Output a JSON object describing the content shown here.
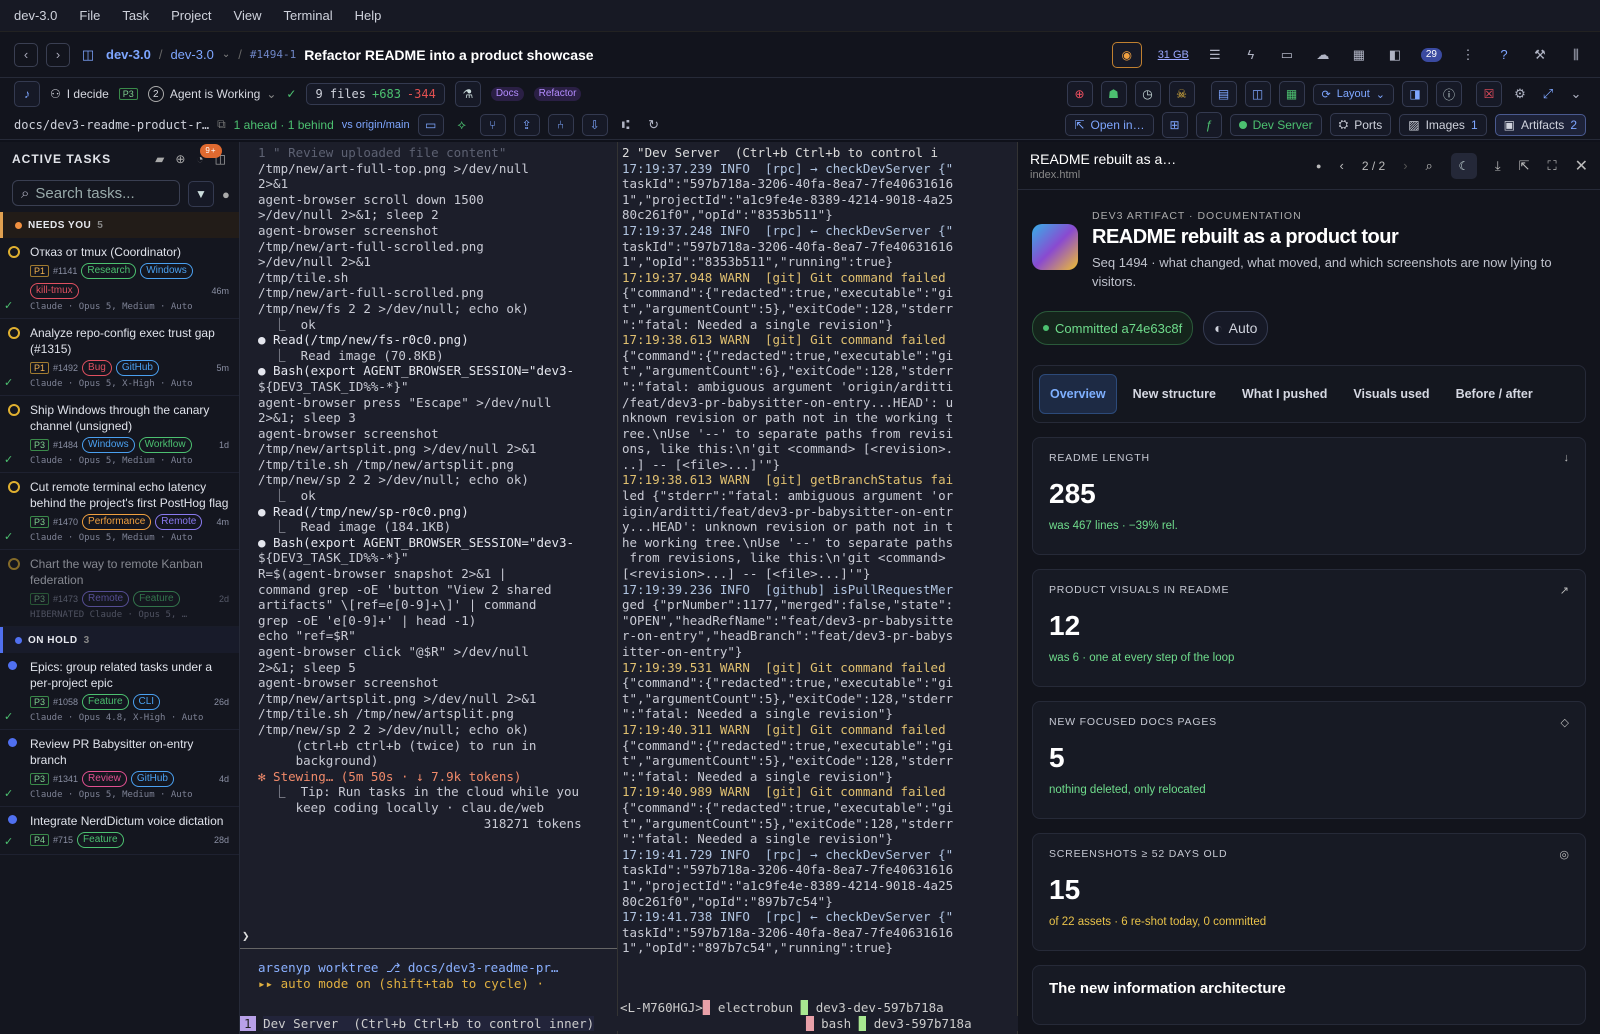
{
  "menu": [
    "dev-3.0",
    "File",
    "Task",
    "Project",
    "View",
    "Terminal",
    "Help"
  ],
  "titlebar": {
    "crumb1": "dev-3.0",
    "crumb2": "dev-3.0",
    "task_id": "#1494-1",
    "task_title": "Refactor README into a product showcase",
    "mem": "31 GB",
    "badge": "29"
  },
  "toolbar": {
    "decide": "I decide",
    "priority": "P3",
    "agent_num": "2",
    "agent_status": "Agent is Working",
    "files": "9 files",
    "added": "+683",
    "removed": "-344",
    "tag1": "Docs",
    "tag2": "Refactor",
    "layout": "Layout"
  },
  "toolbar2": {
    "branch": "docs/dev3-readme-product-r…",
    "ahead": "1 ahead · 1 behind",
    "origin": "vs origin/main",
    "open_in": "Open in…",
    "dev_server": "Dev Server",
    "ports": "Ports",
    "images": "Images",
    "images_n": "1",
    "artifacts": "Artifacts",
    "artifacts_n": "2"
  },
  "sidebar": {
    "title": "ACTIVE TASKS",
    "notif": "9+",
    "search_placeholder": "Search tasks...",
    "needs_label": "NEEDS YOU",
    "needs_count": "5",
    "hold_label": "ON HOLD",
    "hold_count": "3",
    "needs": [
      {
        "title": "Отказ от tmux (Coordinator)",
        "pri": "P1",
        "id": "#1141",
        "tags": [
          "Research",
          "Windows",
          "kill-tmux"
        ],
        "age": "46m",
        "foot": "Claude · Opus 5, Medium · Auto"
      },
      {
        "title": "Analyze repo-config exec trust gap (#1315)",
        "pri": "P1",
        "id": "#1492",
        "tags": [
          "Bug",
          "GitHub"
        ],
        "age": "5m",
        "foot": "Claude · Opus 5, X-High · Auto"
      },
      {
        "title": "Ship Windows through the canary channel (unsigned)",
        "pri": "P3",
        "id": "#1484",
        "tags": [
          "Windows",
          "Workflow"
        ],
        "age": "1d",
        "foot": "Claude · Opus 5, Medium · Auto"
      },
      {
        "title": "Cut remote terminal echo latency behind the project's first PostHog flag",
        "pri": "P3",
        "id": "#1470",
        "tags": [
          "Performance",
          "Remote"
        ],
        "age": "4m",
        "foot": "Claude · Opus 5, Medium · Auto"
      },
      {
        "title": "Chart the way to remote Kanban federation",
        "pri": "P3",
        "id": "#1473",
        "tags": [
          "Remote",
          "Feature"
        ],
        "age": "2d",
        "foot": "HIBERNATED  Claude · Opus 5, …"
      }
    ],
    "hold": [
      {
        "title": "Epics: group related tasks under a per-project epic",
        "pri": "P3",
        "id": "#1058",
        "tags": [
          "Feature",
          "CLI"
        ],
        "age": "26d",
        "foot": "Claude · Opus 4.8, X-High · Auto"
      },
      {
        "title": "Review PR Babysitter on-entry branch",
        "pri": "P3",
        "id": "#1341",
        "tags": [
          "Review",
          "GitHub"
        ],
        "age": "4d",
        "foot": "Claude · Opus 5, Medium · Auto"
      },
      {
        "title": "Integrate NerdDictum voice dictation",
        "pri": "P4",
        "id": "#715",
        "tags": [
          "Feature"
        ],
        "age": "28d",
        "foot": ""
      }
    ]
  },
  "term1": [
    "1 \" Review uploaded file content\"",
    "/tmp/new/art-full-top.png >/dev/null",
    "2>&1",
    "agent-browser scroll down 1500",
    ">/dev/null 2>&1; sleep 2",
    "agent-browser screenshot",
    "/tmp/new/art-full-scrolled.png",
    ">/dev/null 2>&1",
    "/tmp/tile.sh",
    "/tmp/new/art-full-scrolled.png",
    "/tmp/new/fs 2 2 >/dev/null; echo ok)",
    "  ⎿  ok",
    "",
    "● Read(/tmp/new/fs-r0c0.png)",
    "  ⎿  Read image (70.8KB)",
    "",
    "● Bash(export AGENT_BROWSER_SESSION=\"dev3-",
    "${DEV3_TASK_ID%%-*}\"",
    "agent-browser press \"Escape\" >/dev/null",
    "2>&1; sleep 3",
    "agent-browser screenshot",
    "/tmp/new/artsplit.png >/dev/null 2>&1",
    "/tmp/tile.sh /tmp/new/artsplit.png",
    "/tmp/new/sp 2 2 >/dev/null; echo ok)",
    "  ⎿  ok",
    "",
    "● Read(/tmp/new/sp-r0c0.png)",
    "  ⎿  Read image (184.1KB)",
    "",
    "● Bash(export AGENT_BROWSER_SESSION=\"dev3-",
    "${DEV3_TASK_ID%%-*}\"",
    "R=$(agent-browser snapshot 2>&1 |",
    "command grep -oE 'button \"View 2 shared",
    "artifacts\" \\[ref=e[0-9]+\\]' | command",
    "grep -oE 'e[0-9]+' | head -1)",
    "echo \"ref=$R\"",
    "agent-browser click \"@$R\" >/dev/null",
    "2>&1; sleep 5",
    "agent-browser screenshot",
    "/tmp/new/artsplit.png >/dev/null 2>&1",
    "/tmp/tile.sh /tmp/new/artsplit.png",
    "/tmp/new/sp 2 2 >/dev/null; echo ok)",
    "     (ctrl+b ctrl+b (twice) to run in",
    "     background)",
    "",
    "✻ Stewing… (5m 50s · ↓ 7.9k tokens)",
    "  ⎿  Tip: Run tasks in the cloud while you",
    "     keep coding locally · clau.de/web",
    "                              318271 tokens"
  ],
  "term1_prompt": {
    "user": "arsenyp",
    "wt": "worktree",
    "path": "⎇ docs/dev3-readme-pr…",
    "auto": "▸▸ auto mode on (shift+tab to cycle) ·"
  },
  "tmux_status": {
    "win": "1",
    "left": "Dev Server  (Ctrl+b Ctrl+b to control inner)",
    "host": "<L-M760HGJ>",
    "app": "electrobun",
    "sess1": "dev3-dev-597b718a",
    "sess2": "bash",
    "sess3": "dev3-597b718a"
  },
  "term2": [
    "2 \"Dev Server  (Ctrl+b Ctrl+b to control i",
    "17:19:37.239 INFO  [rpc] → checkDevServer {\"",
    "taskId\":\"597b718a-3206-40fa-8ea7-7fe40631616",
    "1\",\"projectId\":\"a1c9fe4e-8389-4214-9018-4a25",
    "80c261f0\",\"opId\":\"8353b511\"}",
    "17:19:37.248 INFO  [rpc] ← checkDevServer {\"",
    "taskId\":\"597b718a-3206-40fa-8ea7-7fe40631616",
    "1\",\"opId\":\"8353b511\",\"running\":true}",
    "17:19:37.948 WARN  [git] Git command failed",
    "{\"command\":{\"redacted\":true,\"executable\":\"gi",
    "t\",\"argumentCount\":5},\"exitCode\":128,\"stderr",
    "\":\"fatal: Needed a single revision\"}",
    "17:19:38.613 WARN  [git] Git command failed",
    "{\"command\":{\"redacted\":true,\"executable\":\"gi",
    "t\",\"argumentCount\":6},\"exitCode\":128,\"stderr",
    "\":\"fatal: ambiguous argument 'origin/arditti",
    "/feat/dev3-pr-babysitter-on-entry...HEAD': u",
    "nknown revision or path not in the working t",
    "ree.\\nUse '--' to separate paths from revisi",
    "ons, like this:\\n'git <command> [<revision>.",
    "..] -- [<file>...]'\"}",
    "17:19:38.613 WARN  [git] getBranchStatus fai",
    "led {\"stderr\":\"fatal: ambiguous argument 'or",
    "igin/arditti/feat/dev3-pr-babysitter-on-entr",
    "y...HEAD': unknown revision or path not in t",
    "he working tree.\\nUse '--' to separate paths",
    " from revisions, like this:\\n'git <command>",
    "[<revision>...] -- [<file>...]'\"}",
    "17:19:39.236 INFO  [github] isPullRequestMer",
    "ged {\"prNumber\":1177,\"merged\":false,\"state\":",
    "\"OPEN\",\"headRefName\":\"feat/dev3-pr-babysitte",
    "r-on-entry\",\"headBranch\":\"feat/dev3-pr-babys",
    "itter-on-entry\"}",
    "17:19:39.531 WARN  [git] Git command failed",
    "{\"command\":{\"redacted\":true,\"executable\":\"gi",
    "t\",\"argumentCount\":5},\"exitCode\":128,\"stderr",
    "\":\"fatal: Needed a single revision\"}",
    "17:19:40.311 WARN  [git] Git command failed",
    "{\"command\":{\"redacted\":true,\"executable\":\"gi",
    "t\",\"argumentCount\":5},\"exitCode\":128,\"stderr",
    "\":\"fatal: Needed a single revision\"}",
    "17:19:40.989 WARN  [git] Git command failed",
    "{\"command\":{\"redacted\":true,\"executable\":\"gi",
    "t\",\"argumentCount\":5},\"exitCode\":128,\"stderr",
    "\":\"fatal: Needed a single revision\"}",
    "17:19:41.729 INFO  [rpc] → checkDevServer {\"",
    "taskId\":\"597b718a-3206-40fa-8ea7-7fe40631616",
    "1\",\"projectId\":\"a1c9fe4e-8389-4214-9018-4a25",
    "80c261f0\",\"opId\":\"897b7c54\"}",
    "17:19:41.738 INFO  [rpc] ← checkDevServer {\"",
    "taskId\":\"597b718a-3206-40fa-8ea7-7fe40631616",
    "1\",\"opId\":\"897b7c54\",\"running\":true}"
  ],
  "panel": {
    "title": "README rebuilt as a…",
    "file": "index.html",
    "page": "2",
    "pages": "2",
    "eyebrow": "DEV3 ARTIFACT · DOCUMENTATION",
    "heading": "README rebuilt as a product tour",
    "desc": "Seq 1494 · what changed, what moved, and which screenshots are now lying to visitors.",
    "commit": "Committed a74e63c8f",
    "auto": "Auto",
    "tabs": [
      "Overview",
      "New structure",
      "What I pushed",
      "Visuals used",
      "Before / after"
    ],
    "cards": [
      {
        "label": "README LENGTH",
        "num": "285",
        "sub": "was 467 lines · −39% rel.",
        "icon": "↓",
        "color": "#6fdc8c"
      },
      {
        "label": "PRODUCT VISUALS IN README",
        "num": "12",
        "sub": "was 6 · one at every step of the loop",
        "icon": "↗",
        "color": "#6fdc8c"
      },
      {
        "label": "NEW FOCUSED DOCS PAGES",
        "num": "5",
        "sub": "nothing deleted, only relocated",
        "icon": "◇",
        "color": "#6fdc8c"
      },
      {
        "label": "SCREENSHOTS ≥ 52 DAYS OLD",
        "num": "15",
        "sub": "of 22 assets · 6 re-shot today, 0 committed",
        "icon": "◎",
        "color": "#e8c24a"
      }
    ],
    "section": "The new information architecture"
  }
}
